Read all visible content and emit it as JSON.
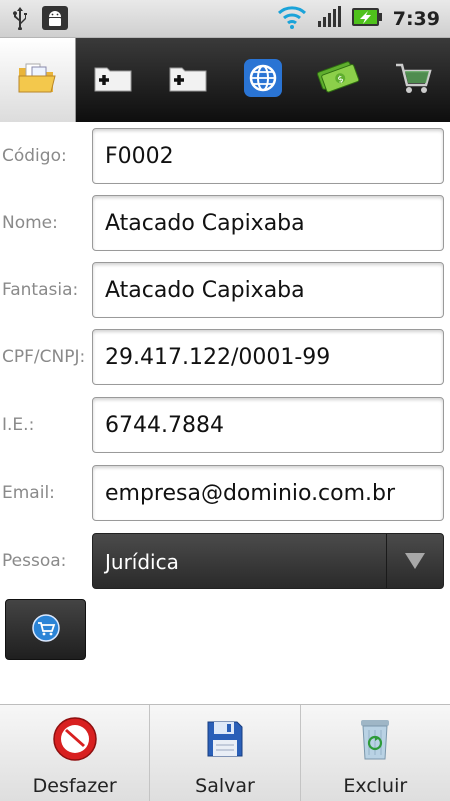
{
  "status_bar": {
    "time": "7:39",
    "icons": [
      "usb-icon",
      "android-debug-icon",
      "wifi-icon",
      "signal-icon",
      "battery-charging-icon"
    ]
  },
  "tabs": [
    {
      "icon": "folder-icon",
      "active": true
    },
    {
      "icon": "folder-add-icon",
      "active": false
    },
    {
      "icon": "folder-add-icon",
      "active": false
    },
    {
      "icon": "globe-icon",
      "active": false
    },
    {
      "icon": "money-icon",
      "active": false
    },
    {
      "icon": "cart-icon",
      "active": false
    }
  ],
  "form": {
    "codigo": {
      "label": "Código:",
      "value": "F0002"
    },
    "nome": {
      "label": "Nome:",
      "value": "Atacado Capixaba"
    },
    "fantasia": {
      "label": "Fantasia:",
      "value": "Atacado Capixaba"
    },
    "cpf_cnpj": {
      "label": "CPF/CNPJ:",
      "value": "29.417.122/0001-99"
    },
    "ie": {
      "label": "I.E.:",
      "value": "6744.7884"
    },
    "email": {
      "label": "Email:",
      "value": "empresa@dominio.com.br"
    },
    "pessoa": {
      "label": "Pessoa:",
      "value": "Jurídica"
    }
  },
  "cart_button": {
    "icon": "cart-icon"
  },
  "bottom_bar": {
    "undo": {
      "label": "Desfazer",
      "icon": "no-entry-icon"
    },
    "save": {
      "label": "Salvar",
      "icon": "floppy-disk-icon"
    },
    "delete": {
      "label": "Excluir",
      "icon": "recycle-bin-icon"
    }
  },
  "colors": {
    "label": "#8a8a8a",
    "tabbar": "#1a1a1a",
    "undo_red": "#d82020",
    "save_blue": "#2a5fb8"
  }
}
